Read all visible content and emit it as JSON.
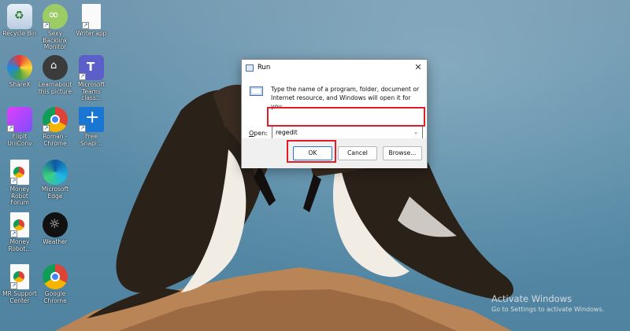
{
  "desktop": {
    "icons": [
      {
        "label": "Recycle Bin",
        "icon": "recycle-bin-icon"
      },
      {
        "label": "Sexy Backlink Monitor",
        "icon": "links-icon"
      },
      {
        "label": "Writer.app",
        "icon": "file-icon"
      },
      {
        "label": "ShareX",
        "icon": "sharex-icon"
      },
      {
        "label": "Learnabout this picture",
        "icon": "spotlight-icon"
      },
      {
        "label": "Microsoft Teams class...",
        "icon": "teams-icon"
      },
      {
        "label": "FlipIt UniConv",
        "icon": "app-icon"
      },
      {
        "label": "Roman - Chrome",
        "icon": "chrome-icon"
      },
      {
        "label": "Free Snapi...",
        "icon": "plus-icon"
      },
      {
        "label": "Money Robot Forum",
        "icon": "chrome-shortcut-icon"
      },
      {
        "label": "Microsoft Edge",
        "icon": "edge-icon"
      },
      {
        "label": "Money Robot...",
        "icon": "chrome-shortcut-icon"
      },
      {
        "label": "Weather",
        "icon": "weather-icon"
      },
      {
        "label": "MR Support Center",
        "icon": "chrome-shortcut-icon"
      },
      {
        "label": "Google Chrome",
        "icon": "chrome-icon"
      }
    ]
  },
  "run_dialog": {
    "title": "Run",
    "close_glyph": "✕",
    "description": "Type the name of a program, folder, document or Internet resource, and Windows will open it for you.",
    "open_label_prefix": "",
    "open_label_underlined": "O",
    "open_label_rest": "pen:",
    "open_value": "regedit",
    "chevron": "⌄",
    "ok_label": "OK",
    "cancel_label": "Cancel",
    "browse_label": "Browse..."
  },
  "watermark": {
    "line1": "Activate Windows",
    "line2": "Go to Settings to activate Windows."
  },
  "colors": {
    "accent": "#2b78d4",
    "highlight": "#e11d2a"
  }
}
